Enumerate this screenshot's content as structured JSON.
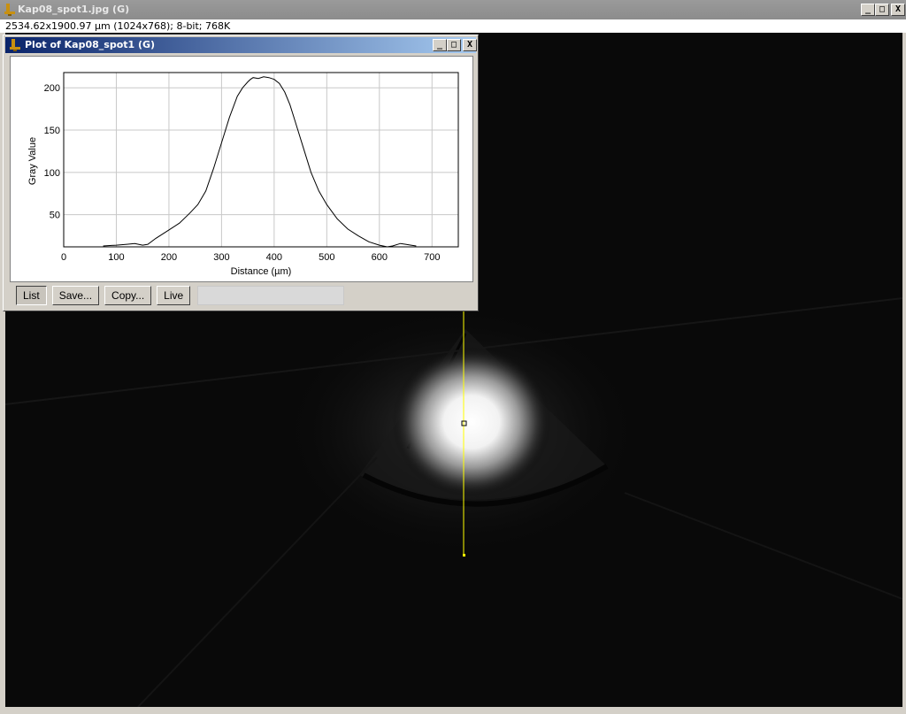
{
  "main_window": {
    "title": "Kap08_spot1.jpg (G)",
    "info": "2534.62x1900.97 µm (1024x768); 8-bit; 768K",
    "buttons": [
      "_",
      "□",
      "X"
    ]
  },
  "plot_window": {
    "title": "Plot of Kap08_spot1 (G)",
    "buttons": [
      "_",
      "□",
      "X"
    ],
    "action_buttons": {
      "list": "List",
      "save": "Save...",
      "copy": "Copy...",
      "live": "Live"
    },
    "readout": ""
  },
  "colors": {
    "title_active_start": "#0a246a",
    "title_active_end": "#a6caf0",
    "title_inactive": "#8c8c8c",
    "selection_line": "#ffff00",
    "plot_line": "#000000"
  },
  "chart_data": {
    "type": "line",
    "xlabel": "Distance (µm)",
    "ylabel": "Gray Value",
    "xlim": [
      0,
      750
    ],
    "ylim": [
      12,
      218
    ],
    "x_ticks": [
      0,
      100,
      200,
      300,
      400,
      500,
      600,
      700
    ],
    "y_ticks": [
      50,
      100,
      150,
      200
    ],
    "grid": true,
    "series": [
      {
        "x": [
          75,
          100,
          120,
          135,
          150,
          160,
          175,
          200,
          220,
          240,
          255,
          270,
          285,
          300,
          315,
          330,
          340,
          350,
          355,
          360,
          370,
          380,
          390,
          400,
          410,
          420,
          430,
          440,
          455,
          470,
          485,
          500,
          520,
          540,
          560,
          580,
          600,
          615,
          625,
          640,
          650,
          660,
          670
        ],
        "y": [
          13,
          14,
          15,
          16,
          14,
          15,
          22,
          32,
          40,
          52,
          62,
          78,
          105,
          135,
          165,
          190,
          200,
          207,
          210,
          212,
          211,
          213,
          212,
          210,
          205,
          195,
          180,
          160,
          130,
          100,
          78,
          62,
          45,
          33,
          25,
          18,
          14,
          12,
          13,
          16,
          15,
          14,
          13
        ]
      }
    ]
  }
}
